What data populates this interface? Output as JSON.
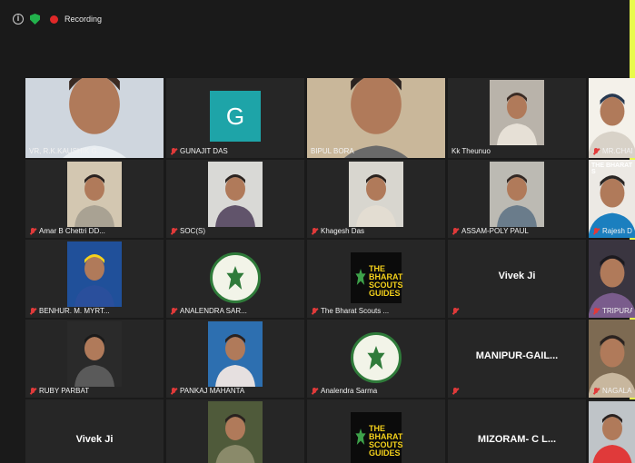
{
  "window": {
    "recording_label": "Recording"
  },
  "participants": [
    {
      "name": "VR, R.K.KAUSHIK G...",
      "muted": false,
      "active": true,
      "kind": "video"
    },
    {
      "name": "GUNAJIT DAS",
      "muted": true,
      "kind": "letter",
      "letter": "G"
    },
    {
      "name": "BIPUL BORA",
      "muted": false,
      "kind": "video"
    },
    {
      "name": "Kk Theunuo",
      "muted": false,
      "kind": "video"
    },
    {
      "name": "MR.CHAN",
      "muted": true,
      "kind": "video"
    },
    {
      "name": "Amar B Chettri DD...",
      "muted": true,
      "kind": "video"
    },
    {
      "name": "SOC(S)",
      "muted": true,
      "kind": "video"
    },
    {
      "name": "Khagesh Das",
      "muted": true,
      "kind": "video"
    },
    {
      "name": "ASSAM-POLY PAUL",
      "muted": true,
      "kind": "video"
    },
    {
      "name": "Rajesh D",
      "muted": true,
      "kind": "video",
      "overlay_text": "THE BHARAT S"
    },
    {
      "name": "BENHUR. M. MYRT...",
      "muted": true,
      "kind": "video"
    },
    {
      "name": "ANALENDRA SAR...",
      "muted": true,
      "kind": "logo-round"
    },
    {
      "name": "The Bharat Scouts ...",
      "muted": true,
      "kind": "logo-black"
    },
    {
      "name": "",
      "muted": true,
      "kind": "text",
      "display": "Vivek Ji"
    },
    {
      "name": "TRIPURA",
      "muted": true,
      "kind": "video"
    },
    {
      "name": "RUBY PARBAT",
      "muted": true,
      "kind": "video"
    },
    {
      "name": "PANKAJ MAHANTA",
      "muted": true,
      "kind": "video"
    },
    {
      "name": "Analendra Sarma",
      "muted": true,
      "kind": "logo-round"
    },
    {
      "name": "",
      "muted": true,
      "kind": "text",
      "display": "MANIPUR-GAIL..."
    },
    {
      "name": "NAGALA",
      "muted": true,
      "kind": "video"
    },
    {
      "name": "",
      "muted": false,
      "kind": "text",
      "display": "Vivek Ji"
    },
    {
      "name": "",
      "muted": false,
      "kind": "video"
    },
    {
      "name": "",
      "muted": false,
      "kind": "logo-black"
    },
    {
      "name": "",
      "muted": false,
      "kind": "text",
      "display": "MIZORAM- C L..."
    },
    {
      "name": "",
      "muted": false,
      "kind": "video"
    }
  ],
  "logo_text": {
    "line1": "THE BHARAT",
    "line2": "SCOUTS",
    "line3": "GUIDES"
  },
  "colors": {
    "accent": "#e8fb4a",
    "active_outline": "#b7e34b",
    "mute": "#e03a3a",
    "avatar": "#1ea4a8"
  }
}
